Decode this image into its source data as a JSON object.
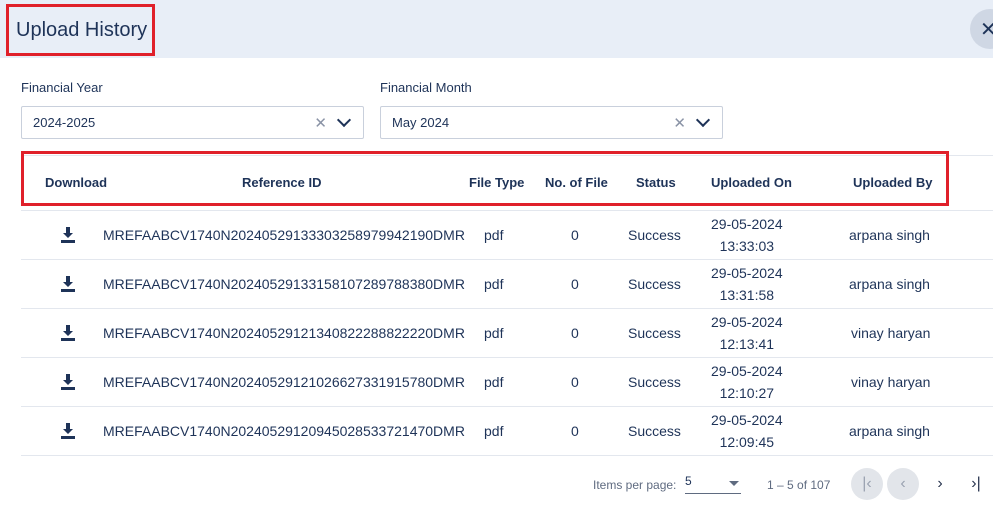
{
  "dialog": {
    "title": "Upload History",
    "close_icon": "close-icon"
  },
  "filters": {
    "year": {
      "label": "Financial Year",
      "value": "2024-2025"
    },
    "month": {
      "label": "Financial Month",
      "value": "May 2024"
    },
    "clear_glyph": "✕"
  },
  "table": {
    "columns": [
      "Download",
      "Reference ID",
      "File Type",
      "No. of File",
      "Status",
      "Uploaded On",
      "Uploaded By"
    ],
    "rows": [
      {
        "ref": "MREFAABCV1740N20240529133303258979942190DMR",
        "type": "pdf",
        "count": "0",
        "status": "Success",
        "date": "29-05-2024",
        "time": "13:33:03",
        "by": "arpana singh"
      },
      {
        "ref": "MREFAABCV1740N20240529133158107289788380DMR",
        "type": "pdf",
        "count": "0",
        "status": "Success",
        "date": "29-05-2024",
        "time": "13:31:58",
        "by": "arpana singh"
      },
      {
        "ref": "MREFAABCV1740N20240529121340822288822220DMR",
        "type": "pdf",
        "count": "0",
        "status": "Success",
        "date": "29-05-2024",
        "time": "12:13:41",
        "by": "vinay haryan"
      },
      {
        "ref": "MREFAABCV1740N20240529121026627331915780DMR",
        "type": "pdf",
        "count": "0",
        "status": "Success",
        "date": "29-05-2024",
        "time": "12:10:27",
        "by": "vinay haryan"
      },
      {
        "ref": "MREFAABCV1740N20240529120945028533721470DMR",
        "type": "pdf",
        "count": "0",
        "status": "Success",
        "date": "29-05-2024",
        "time": "12:09:45",
        "by": "arpana singh"
      }
    ]
  },
  "paginator": {
    "items_per_page_label": "Items per page:",
    "page_size": "5",
    "range": "1 – 5 of 107",
    "first_glyph": "|‹",
    "prev_glyph": "‹",
    "next_glyph": "›",
    "last_glyph": "›|"
  }
}
